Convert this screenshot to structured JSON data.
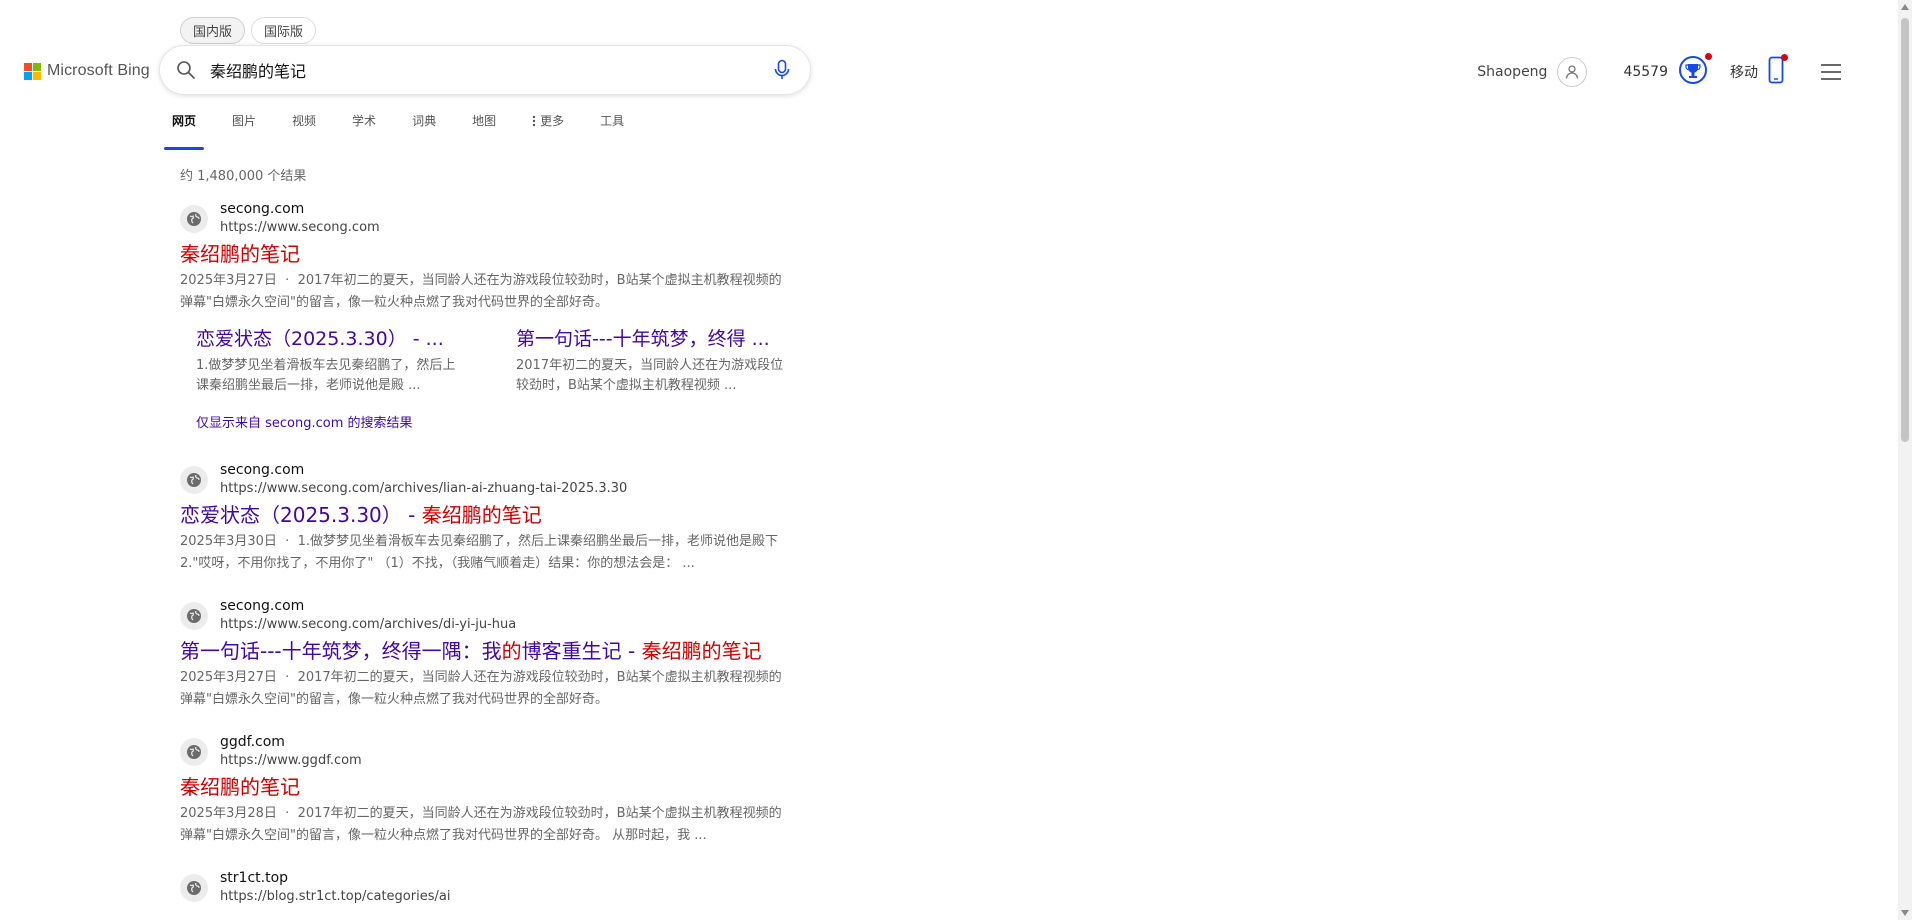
{
  "region_switch": {
    "domestic": "国内版",
    "international": "国际版"
  },
  "logo": {
    "text": "Microsoft Bing",
    "colors": [
      "#f25022",
      "#7fba00",
      "#00a4ef",
      "#ffb900"
    ]
  },
  "search": {
    "query": "秦绍鹏的笔记"
  },
  "header": {
    "user_name": "Shaopeng",
    "points": "45579",
    "mobile_label": "移动"
  },
  "nav": {
    "tabs": [
      {
        "label": "网页"
      },
      {
        "label": "图片"
      },
      {
        "label": "视频"
      },
      {
        "label": "学术"
      },
      {
        "label": "词典"
      },
      {
        "label": "地图"
      },
      {
        "label": "更多"
      },
      {
        "label": "工具"
      }
    ]
  },
  "results_count": "约 1,480,000 个结果",
  "results": [
    {
      "domain": "secong.com",
      "url": "https://www.secong.com",
      "title": "秦绍鹏的笔记",
      "date": "2025年3月27日",
      "snippet": "2017年初二的夏天，当同龄人还在为游戏段位较劲时，B站某个虚拟主机教程视频的弹幕\"白嫖永久空间\"的留言，像一粒火种点燃了我对代码世界的全部好奇。",
      "deeplinks": [
        {
          "title": "恋爱状态（2025.3.30） - ...",
          "snippet": "1.做梦梦见坐着滑板车去见秦绍鹏了，然后上课秦绍鹏坐最后一排，老师说他是殿 ..."
        },
        {
          "title": "第一句话---十年筑梦，终得 ...",
          "snippet": "2017年初二的夏天，当同龄人还在为游戏段位较劲时，B站某个虚拟主机教程视频 ..."
        }
      ],
      "more_from": "仅显示来自 secong.com 的搜索结果"
    },
    {
      "domain": "secong.com",
      "url": "https://www.secong.com/archives/lian-ai-zhuang-tai-2025.3.30",
      "title_main": "恋爱状态（2025.3.30） - ",
      "title_hl": "秦绍鹏的笔记",
      "date": "2025年3月30日",
      "snippet": "1.做梦梦见坐着滑板车去见秦绍鹏了，然后上课秦绍鹏坐最后一排，老师说他是殿下 2.\"哎呀，不用你找了，不用你了\" （1）不找，（我赌气顺着走）结果：你的想法会是： ..."
    },
    {
      "domain": "secong.com",
      "url": "https://www.secong.com/archives/di-yi-ju-hua",
      "title_part1": "第一句话---十年筑梦，终得一隅：我",
      "title_hl1": "的",
      "title_part2": "博客重生记 - ",
      "title_hl2": "秦绍鹏的笔记",
      "date": "2025年3月27日",
      "snippet": "2017年初二的夏天，当同龄人还在为游戏段位较劲时，B站某个虚拟主机教程视频的弹幕\"白嫖永久空间\"的留言，像一粒火种点燃了我对代码世界的全部好奇。"
    },
    {
      "domain": "ggdf.com",
      "url": "https://www.ggdf.com",
      "title": "秦绍鹏的笔记",
      "date": "2025年3月28日",
      "snippet": "2017年初二的夏天，当同龄人还在为游戏段位较劲时，B站某个虚拟主机教程视频的弹幕\"白嫖永久空间\"的留言，像一粒火种点燃了我对代码世界的全部好奇。 从那时起，我 ..."
    },
    {
      "domain": "str1ct.top",
      "url": "https://blog.str1ct.top/categories/ai"
    }
  ],
  "date_separator": "·",
  "colors": {
    "accent": "#174ae4",
    "title_visited": "#4007a2",
    "highlight": "#cc0000"
  }
}
